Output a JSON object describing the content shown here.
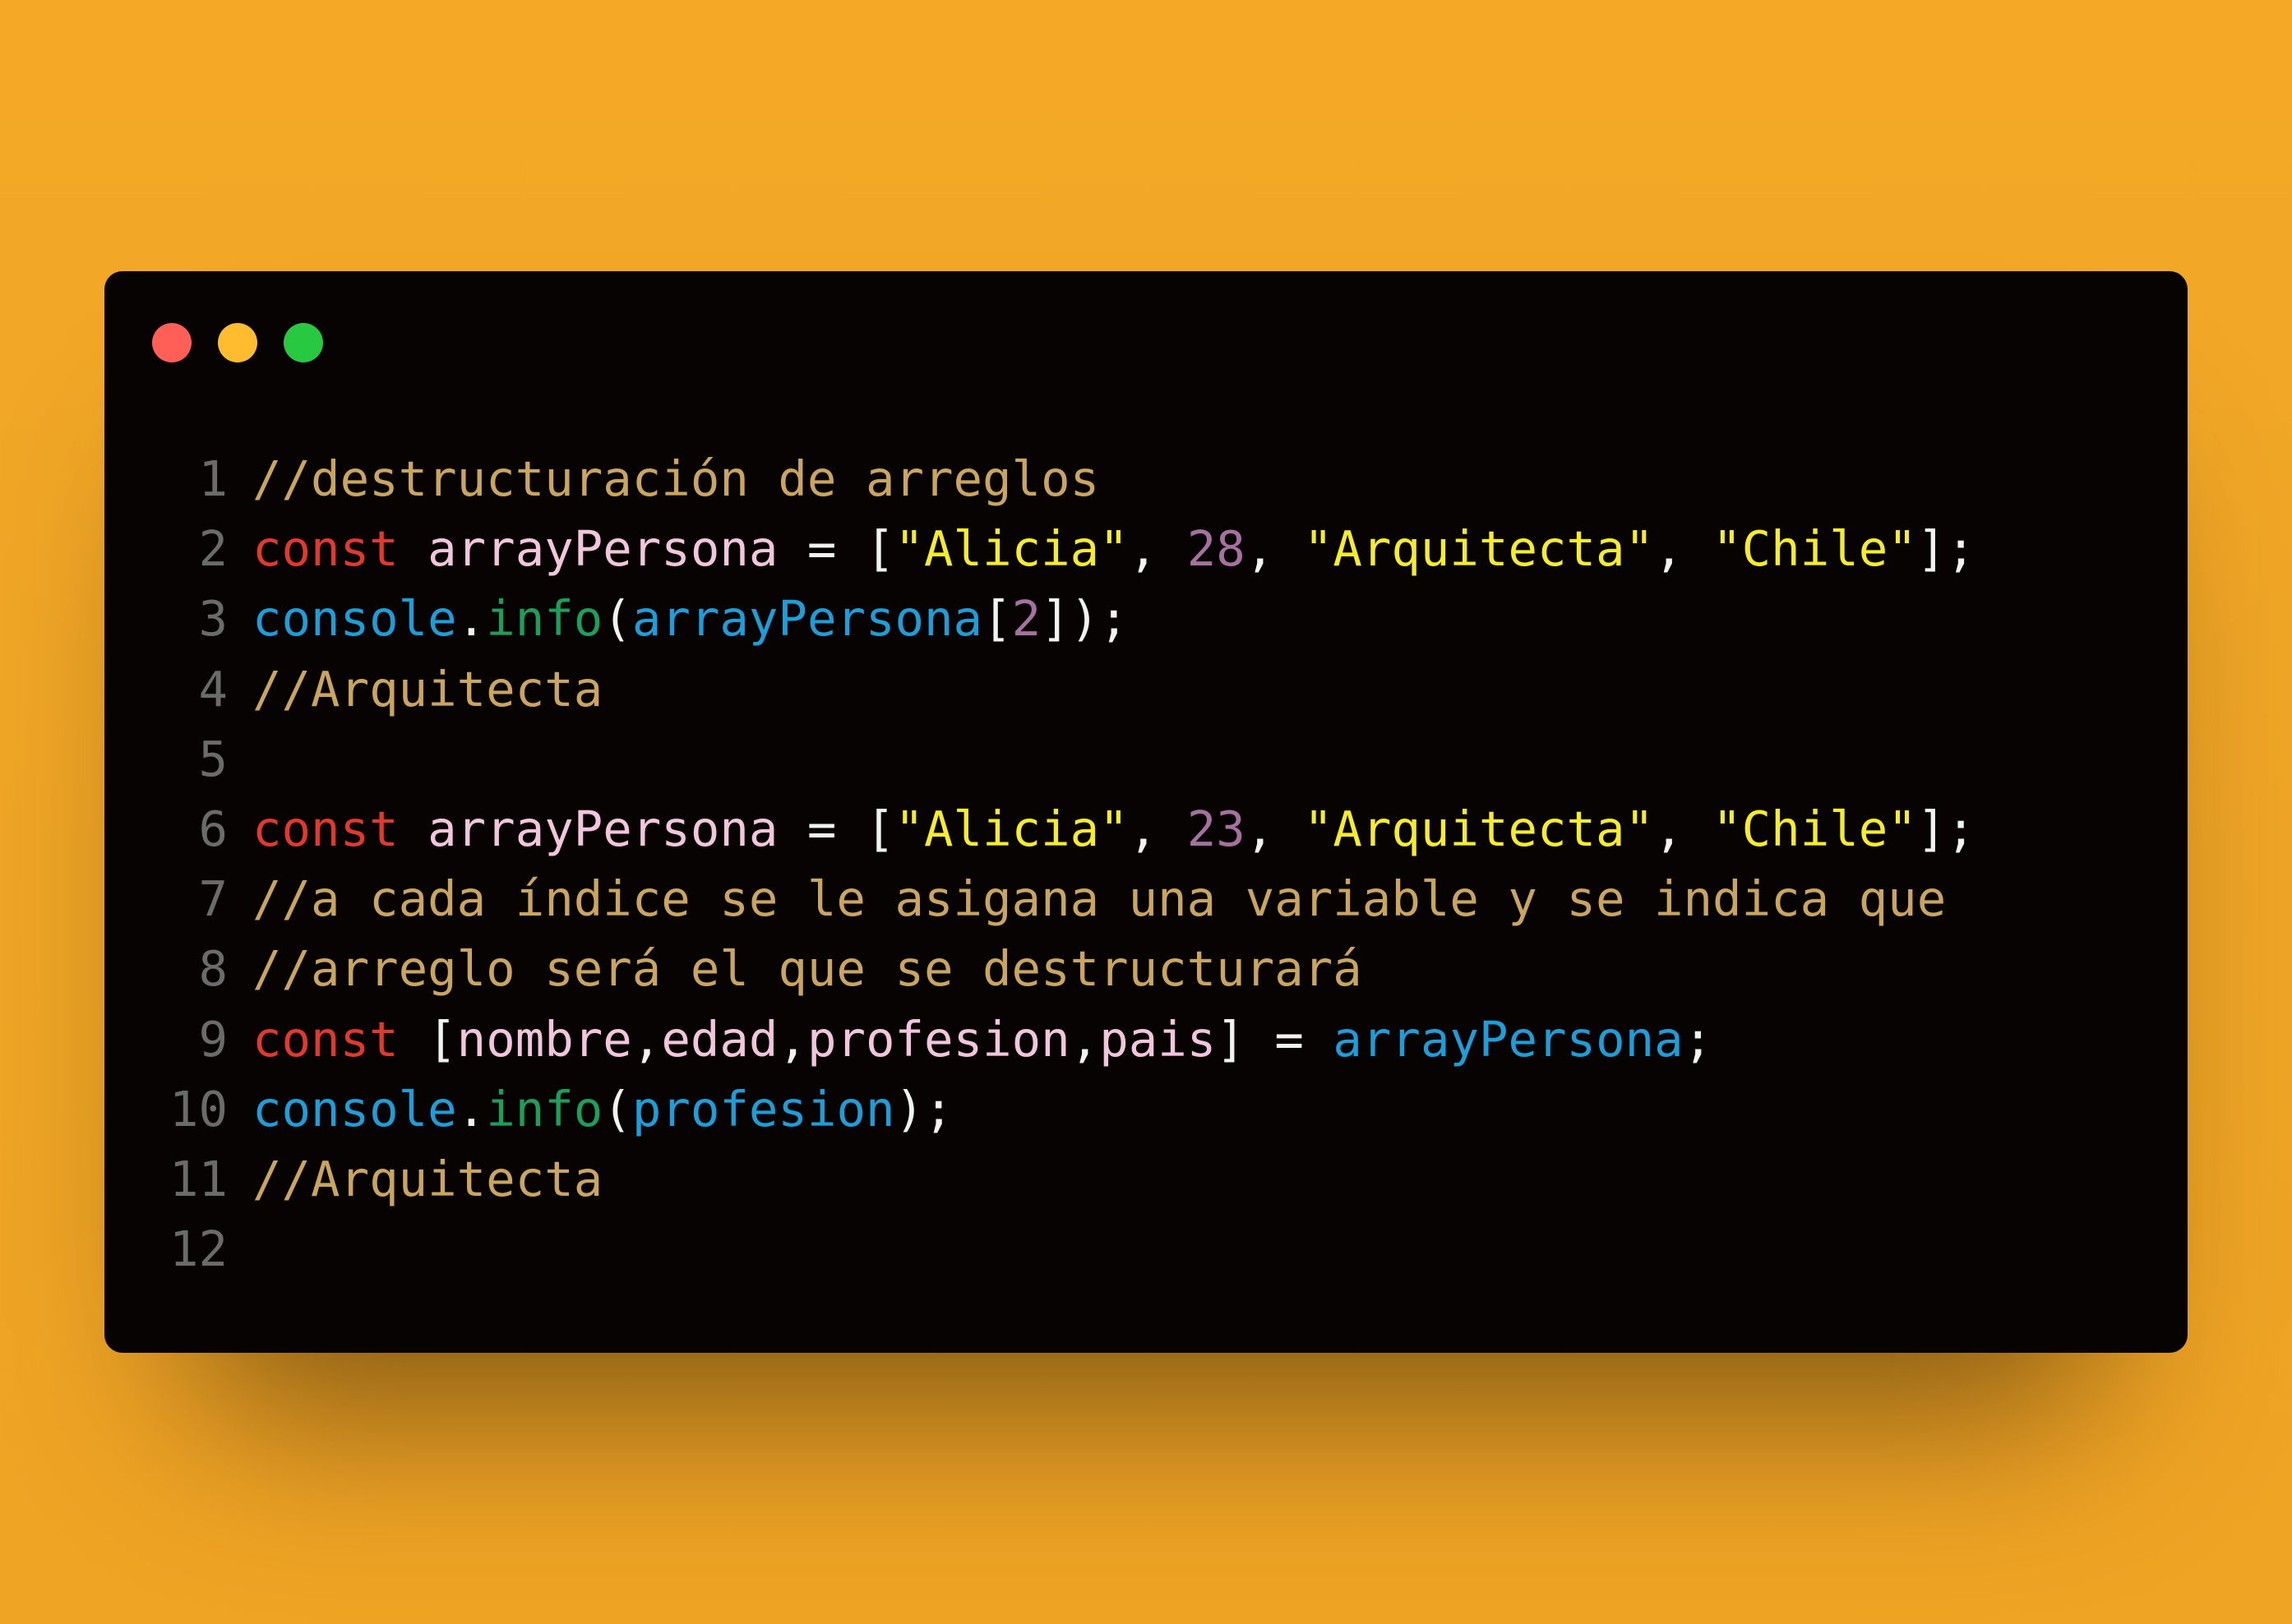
{
  "window": {
    "controls": [
      {
        "name": "close",
        "color": "#ff5f57"
      },
      {
        "name": "minimize",
        "color": "#febc2e"
      },
      {
        "name": "maximize",
        "color": "#28c840"
      }
    ]
  },
  "code_lines": [
    {
      "num": "1",
      "tokens": [
        {
          "t": "//destructuración de arreglos",
          "k": "comment"
        }
      ]
    },
    {
      "num": "2",
      "tokens": [
        {
          "t": "const",
          "k": "keyword"
        },
        {
          "t": " ",
          "k": "op"
        },
        {
          "t": "arrayPersona",
          "k": "var"
        },
        {
          "t": " = ",
          "k": "op"
        },
        {
          "t": "[",
          "k": "punct"
        },
        {
          "t": "\"Alicia\"",
          "k": "string"
        },
        {
          "t": ", ",
          "k": "punct"
        },
        {
          "t": "28",
          "k": "number"
        },
        {
          "t": ", ",
          "k": "punct"
        },
        {
          "t": "\"Arquitecta\"",
          "k": "string"
        },
        {
          "t": ", ",
          "k": "punct"
        },
        {
          "t": "\"Chile\"",
          "k": "string"
        },
        {
          "t": "];",
          "k": "punct"
        }
      ]
    },
    {
      "num": "3",
      "tokens": [
        {
          "t": "console",
          "k": "obj"
        },
        {
          "t": ".",
          "k": "punct"
        },
        {
          "t": "info",
          "k": "fn"
        },
        {
          "t": "(",
          "k": "punct"
        },
        {
          "t": "arrayPersona",
          "k": "ident"
        },
        {
          "t": "[",
          "k": "punct"
        },
        {
          "t": "2",
          "k": "number"
        },
        {
          "t": "]);",
          "k": "punct"
        }
      ]
    },
    {
      "num": "4",
      "tokens": [
        {
          "t": "//Arquitecta",
          "k": "comment"
        }
      ]
    },
    {
      "num": "5",
      "tokens": []
    },
    {
      "num": "6",
      "tokens": [
        {
          "t": "const",
          "k": "keyword"
        },
        {
          "t": " ",
          "k": "op"
        },
        {
          "t": "arrayPersona",
          "k": "var"
        },
        {
          "t": " = ",
          "k": "op"
        },
        {
          "t": "[",
          "k": "punct"
        },
        {
          "t": "\"Alicia\"",
          "k": "string"
        },
        {
          "t": ", ",
          "k": "punct"
        },
        {
          "t": "23",
          "k": "number"
        },
        {
          "t": ", ",
          "k": "punct"
        },
        {
          "t": "\"Arquitecta\"",
          "k": "string"
        },
        {
          "t": ", ",
          "k": "punct"
        },
        {
          "t": "\"Chile\"",
          "k": "string"
        },
        {
          "t": "];",
          "k": "punct"
        }
      ]
    },
    {
      "num": "7",
      "tokens": [
        {
          "t": "//a cada índice se le asigana una variable y se indica que",
          "k": "comment"
        }
      ]
    },
    {
      "num": "8",
      "tokens": [
        {
          "t": "//arreglo será el que se destructurará",
          "k": "comment"
        }
      ]
    },
    {
      "num": "9",
      "tokens": [
        {
          "t": "const",
          "k": "keyword"
        },
        {
          "t": " ",
          "k": "op"
        },
        {
          "t": "[",
          "k": "punct"
        },
        {
          "t": "nombre",
          "k": "var"
        },
        {
          "t": ",",
          "k": "punct"
        },
        {
          "t": "edad",
          "k": "var"
        },
        {
          "t": ",",
          "k": "punct"
        },
        {
          "t": "profesion",
          "k": "var"
        },
        {
          "t": ",",
          "k": "punct"
        },
        {
          "t": "pais",
          "k": "var"
        },
        {
          "t": "] = ",
          "k": "punct"
        },
        {
          "t": "arrayPersona",
          "k": "ident"
        },
        {
          "t": ";",
          "k": "punct"
        }
      ]
    },
    {
      "num": "10",
      "tokens": [
        {
          "t": "console",
          "k": "obj"
        },
        {
          "t": ".",
          "k": "punct"
        },
        {
          "t": "info",
          "k": "fn"
        },
        {
          "t": "(",
          "k": "punct"
        },
        {
          "t": "profesion",
          "k": "ident"
        },
        {
          "t": ");",
          "k": "punct"
        }
      ]
    },
    {
      "num": "11",
      "tokens": [
        {
          "t": "//Arquitecta",
          "k": "comment"
        }
      ]
    },
    {
      "num": "12",
      "tokens": []
    }
  ]
}
